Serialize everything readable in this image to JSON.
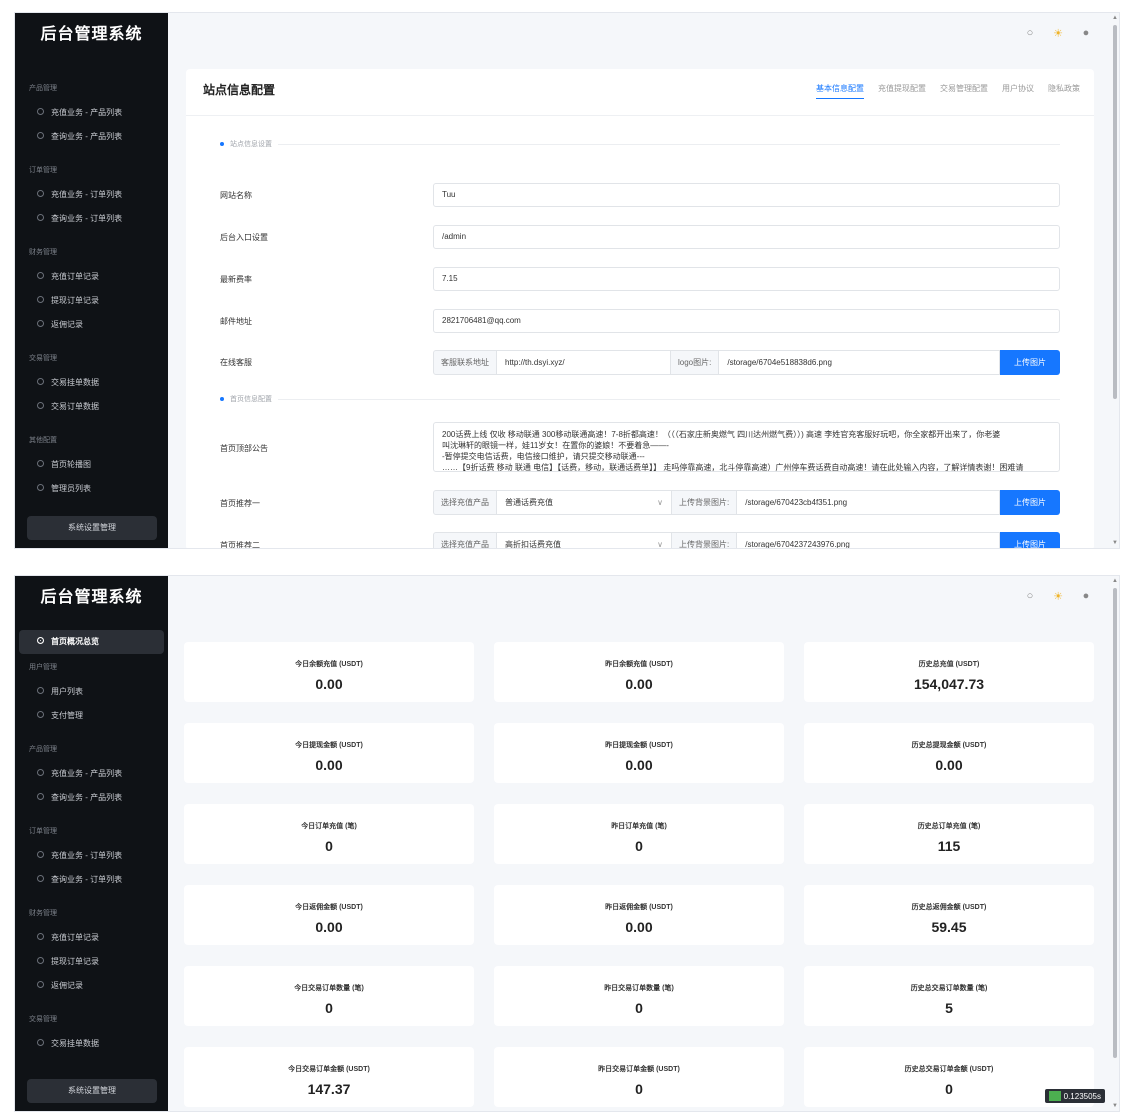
{
  "app": {
    "title": "后台管理系统",
    "settings_button": "系统设置管理"
  },
  "topbar_icons": [
    "refresh-icon",
    "sun-icon",
    "moon-icon"
  ],
  "shot1": {
    "sidebar": [
      {
        "group": "产品管理",
        "items": [
          "充值业务 - 产品列表",
          "查询业务 - 产品列表"
        ]
      },
      {
        "group": "订单管理",
        "items": [
          "充值业务 - 订单列表",
          "查询业务 - 订单列表"
        ]
      },
      {
        "group": "财务管理",
        "items": [
          "充值订单记录",
          "提现订单记录",
          "返佣记录"
        ]
      },
      {
        "group": "交易管理",
        "items": [
          "交易挂单数据",
          "交易订单数据"
        ]
      },
      {
        "group": "其他配置",
        "items": [
          "首页轮播图",
          "管理员列表"
        ]
      }
    ],
    "card_title": "站点信息配置",
    "tabs": [
      "基本信息配置",
      "充值提现配置",
      "交易管理配置",
      "用户协议",
      "隐私政策"
    ],
    "active_tab": 0,
    "section1": "站点信息设置",
    "fields": [
      {
        "label": "网站名称",
        "value": "Tuu"
      },
      {
        "label": "后台入口设置",
        "value": "/admin"
      },
      {
        "label": "最新费率",
        "value": "7.15"
      },
      {
        "label": "邮件地址",
        "value": "2821706481@qq.com"
      }
    ],
    "service": {
      "label": "在线客服",
      "addon1": "客服联系地址",
      "url": "http://th.dsyi.xyz/",
      "addon2": "logo图片:",
      "logo": "/storage/6704e518838d6.png",
      "button": "上传图片"
    },
    "section2": "首页信息配置",
    "notice": {
      "label": "首页顶部公告",
      "lines": [
        "200话费上线 仅收 移动联通 300移动联通高速！7-8折都高速！（（（石家庄新奥燃气 四川达州燃气费））) 高速 李姓官充客服好玩吧，你全家都开出来了，你老婆",
        "叫沈琳轩的眼镜一样，娃11岁女！在置你的婆娘！不要着急——-",
        "-暂停提交电信话费，电信接口维护，请只提交移动联通---",
        "……【9折话费 移动 联通 电信】【话费，移动，联通话费单】】 走吗停靠高速，北斗停靠高速）广州停车费话费自动高速！请在此处输入内容，了解详情表谢！困难请"
      ]
    },
    "recommend": [
      {
        "label": "首页推荐一",
        "addon1": "选择充值产品",
        "product": "普通话费充值",
        "addon2": "上传背景图片:",
        "image": "/storage/670423cb4f351.png",
        "button": "上传图片"
      },
      {
        "label": "首页推荐二",
        "addon1": "选择充值产品",
        "product": "高折扣话费充值",
        "addon2": "上传背景图片:",
        "image": "/storage/6704237243976.png",
        "button": "上传图片"
      }
    ]
  },
  "shot2": {
    "sidebar_active": "首页概况总览",
    "sidebar": [
      {
        "group": "用户管理",
        "items": [
          "用户列表",
          "支付管理"
        ]
      },
      {
        "group": "产品管理",
        "items": [
          "充值业务 - 产品列表",
          "查询业务 - 产品列表"
        ]
      },
      {
        "group": "订单管理",
        "items": [
          "充值业务 - 订单列表",
          "查询业务 - 订单列表"
        ]
      },
      {
        "group": "财务管理",
        "items": [
          "充值订单记录",
          "提现订单记录",
          "返佣记录"
        ]
      },
      {
        "group": "交易管理",
        "items": [
          "交易挂单数据"
        ]
      }
    ],
    "stats": [
      [
        {
          "label": "今日余额充值 (USDT)",
          "value": "0.00"
        },
        {
          "label": "昨日余额充值 (USDT)",
          "value": "0.00"
        },
        {
          "label": "历史总充值 (USDT)",
          "value": "154,047.73"
        }
      ],
      [
        {
          "label": "今日提现金额 (USDT)",
          "value": "0.00"
        },
        {
          "label": "昨日提现金额 (USDT)",
          "value": "0.00"
        },
        {
          "label": "历史总提现金额 (USDT)",
          "value": "0.00"
        }
      ],
      [
        {
          "label": "今日订单充值 (笔)",
          "value": "0"
        },
        {
          "label": "昨日订单充值 (笔)",
          "value": "0"
        },
        {
          "label": "历史总订单充值 (笔)",
          "value": "115"
        }
      ],
      [
        {
          "label": "今日返佣金额 (USDT)",
          "value": "0.00"
        },
        {
          "label": "昨日返佣金额 (USDT)",
          "value": "0.00"
        },
        {
          "label": "历史总返佣金额 (USDT)",
          "value": "59.45"
        }
      ],
      [
        {
          "label": "今日交易订单数量 (笔)",
          "value": "0"
        },
        {
          "label": "昨日交易订单数量 (笔)",
          "value": "0"
        },
        {
          "label": "历史总交易订单数量 (笔)",
          "value": "5"
        }
      ],
      [
        {
          "label": "今日交易订单金额 (USDT)",
          "value": "147.37"
        },
        {
          "label": "昨日交易订单金额 (USDT)",
          "value": "0"
        },
        {
          "label": "历史总交易订单金额 (USDT)",
          "value": "0"
        }
      ]
    ],
    "timer": "0.123505s"
  }
}
